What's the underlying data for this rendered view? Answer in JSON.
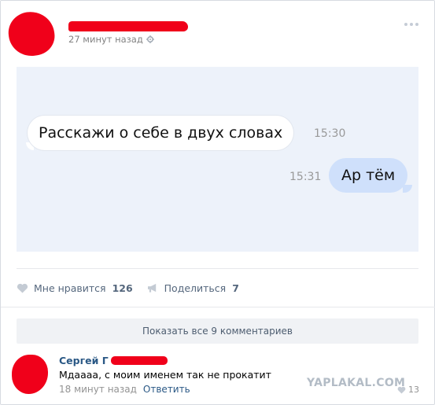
{
  "post": {
    "time": "27 минут назад",
    "icons": {
      "settings": "gear-icon",
      "menu": "more-dots-icon"
    }
  },
  "chat": {
    "incoming_text": "Расскажи о себе в двух словах",
    "incoming_time": "15:30",
    "outgoing_text": "Ар тём",
    "outgoing_time": "15:31",
    "colors": {
      "background": "#edf2fa",
      "incoming_bubble": "#ffffff",
      "outgoing_bubble": "#cfe0fb"
    }
  },
  "actions": {
    "like_label": "Мне нравится",
    "like_count": "126",
    "share_label": "Поделиться",
    "share_count": "7",
    "icons": {
      "like": "heart-icon",
      "share": "megaphone-icon"
    }
  },
  "comments": {
    "show_all_label": "Показать все 9 комментариев",
    "items": [
      {
        "author": "Сергей Г",
        "text": "Мдаааа, с моим именем так не прокатит",
        "time": "18 минут назад",
        "reply_label": "Ответить",
        "likes": "13"
      }
    ]
  },
  "watermark": "YAPLAKAL.COM",
  "redaction_color": "#f0001a",
  "link_color": "#2a5885"
}
